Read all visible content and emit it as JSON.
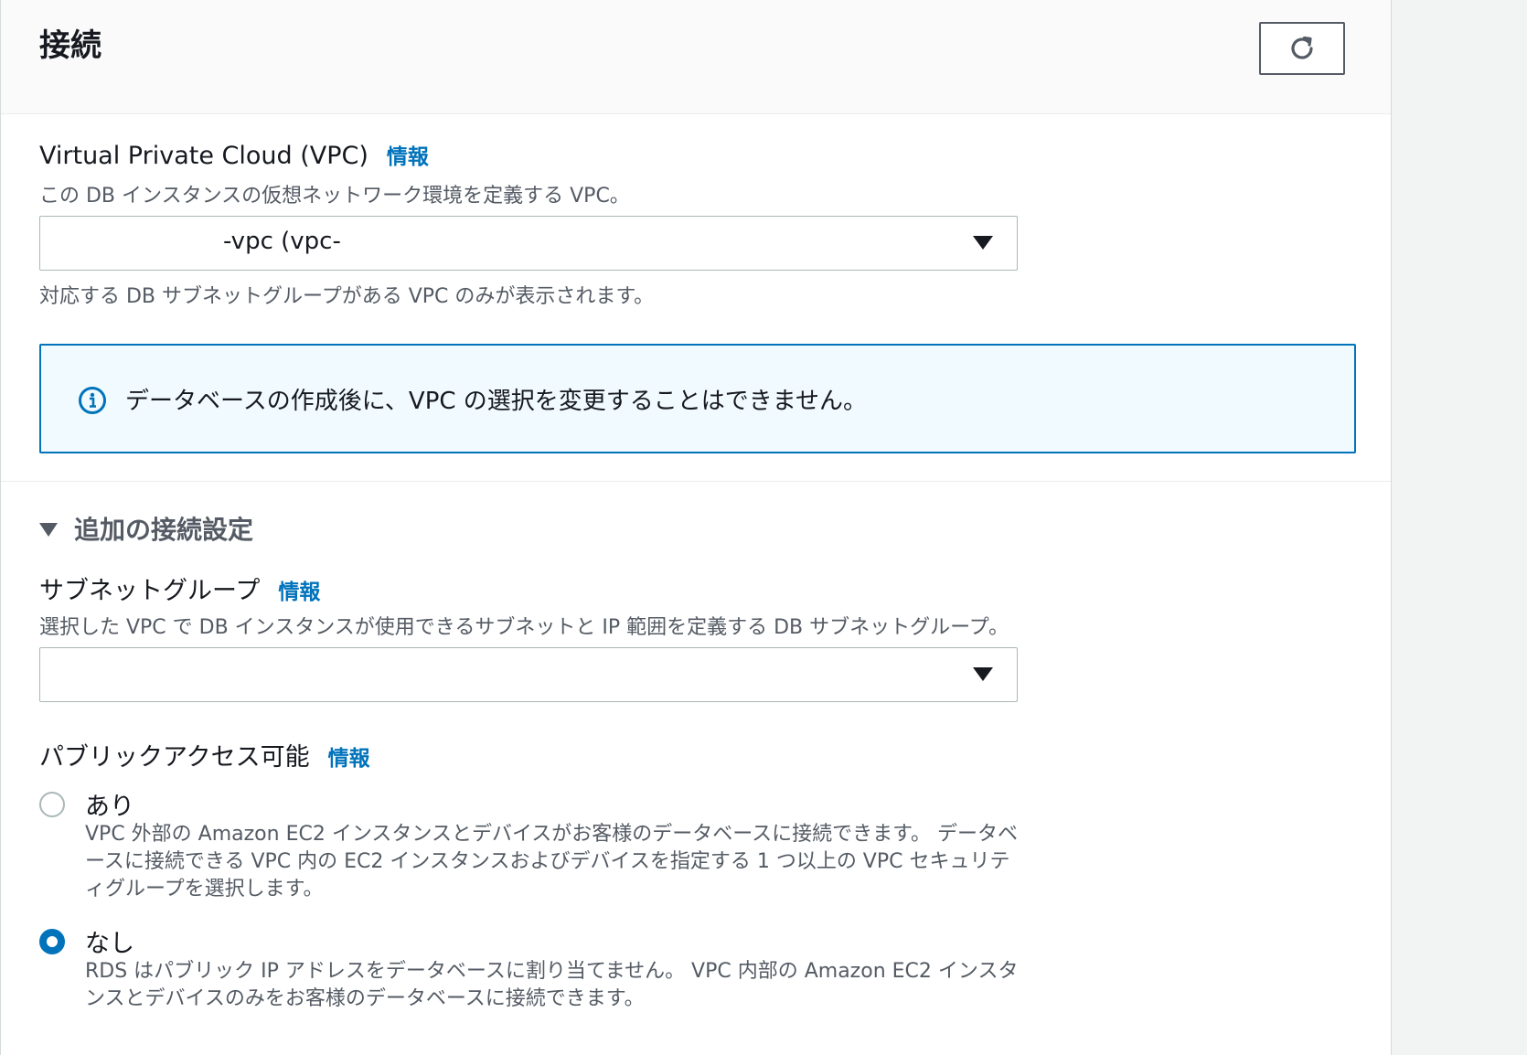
{
  "section": {
    "title": "接続",
    "refresh_icon": "refresh-icon"
  },
  "vpc": {
    "label": "Virtual Private Cloud (VPC)",
    "info": "情報",
    "description": "この DB インスタンスの仮想ネットワーク環境を定義する VPC。",
    "selected_value": "-vpc (vpc-",
    "hint": "対応する DB サブネットグループがある VPC のみが表示されます。"
  },
  "alert": {
    "icon": "info-circle-icon",
    "text": "データベースの作成後に、VPC の選択を変更することはできません。"
  },
  "additional": {
    "label": "追加の接続設定"
  },
  "subnet": {
    "label": "サブネットグループ",
    "info": "情報",
    "description": "選択した VPC で DB インスタンスが使用できるサブネットと IP 範囲を定義する DB サブネットグループ。",
    "selected_value": ""
  },
  "public_access": {
    "label": "パブリックアクセス可能",
    "info": "情報",
    "options": [
      {
        "label": "あり",
        "selected": false,
        "description": "VPC 外部の Amazon EC2 インスタンスとデバイスがお客様のデータベースに接続できます。 データベースに接続できる VPC 内の EC2 インスタンスおよびデバイスを指定する 1 つ以上の VPC セキュリティグループを選択します。"
      },
      {
        "label": "なし",
        "selected": true,
        "description": "RDS はパブリック IP アドレスをデータベースに割り当てません。 VPC 内部の Amazon EC2 インスタンスとデバイスのみをお客様のデータベースに接続できます。"
      }
    ]
  },
  "colors": {
    "accent": "#0073bb",
    "alert_bg": "#f1faff",
    "text": "#16191f",
    "secondary_text": "#545b64"
  }
}
